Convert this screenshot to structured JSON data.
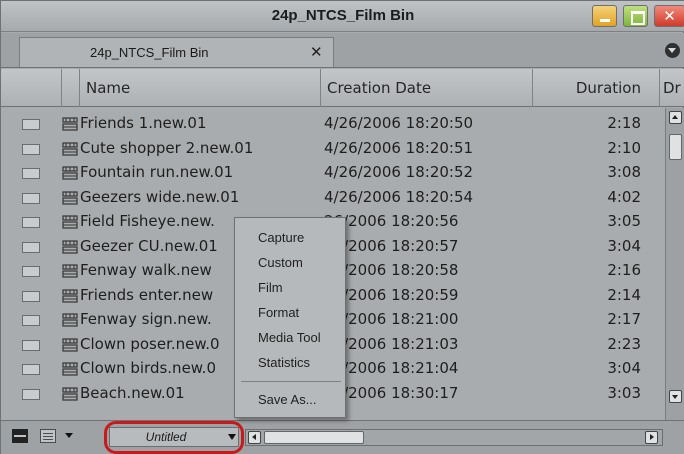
{
  "window": {
    "title": "24p_NTCS_Film Bin",
    "close_glyph": "✕"
  },
  "tab": {
    "label": "24p_NTCS_Film Bin",
    "close_glyph": "✕"
  },
  "columns": {
    "name": "Name",
    "creation_date": "Creation Date",
    "duration": "Duration",
    "truncated": "Dr"
  },
  "rows": [
    {
      "name": "Friends 1.new.01",
      "date": "4/26/2006 18:20:50",
      "duration": "2:18"
    },
    {
      "name": "Cute shopper 2.new.01",
      "date": "4/26/2006 18:20:51",
      "duration": "2:10"
    },
    {
      "name": "Fountain run.new.01",
      "date": "4/26/2006 18:20:52",
      "duration": "3:08"
    },
    {
      "name": "Geezers wide.new.01",
      "date": "4/26/2006 18:20:54",
      "duration": "4:02"
    },
    {
      "name": "Field Fisheye.new.",
      "date": "26/2006 18:20:56",
      "duration": "3:05"
    },
    {
      "name": "Geezer CU.new.01",
      "date": "26/2006 18:20:57",
      "duration": "3:04"
    },
    {
      "name": "Fenway walk.new",
      "date": "26/2006 18:20:58",
      "duration": "2:16"
    },
    {
      "name": "Friends enter.new",
      "date": "26/2006 18:20:59",
      "duration": "2:14"
    },
    {
      "name": "Fenway sign.new.",
      "date": "26/2006 18:21:00",
      "duration": "2:17"
    },
    {
      "name": "Clown poser.new.0",
      "date": "26/2006 18:21:03",
      "duration": "2:23"
    },
    {
      "name": "Clown birds.new.0",
      "date": "26/2006 18:21:04",
      "duration": "3:04"
    },
    {
      "name": "Beach.new.01",
      "date": "26/2006 18:30:17",
      "duration": "3:03"
    }
  ],
  "bottom_bar": {
    "bin_view": "Untitled"
  },
  "menu": {
    "items": [
      "Capture",
      "Custom",
      "Film",
      "Format",
      "Media Tool",
      "Statistics"
    ],
    "save_as": "Save As..."
  },
  "icons": {
    "minimize": "minimize-icon",
    "maximize": "maximize-icon",
    "close": "close-icon",
    "clip": "clip-icon",
    "frame_view": "frame-view-icon",
    "text_view": "text-view-icon"
  },
  "colors": {
    "highlight_outline": "#c81a1a"
  }
}
